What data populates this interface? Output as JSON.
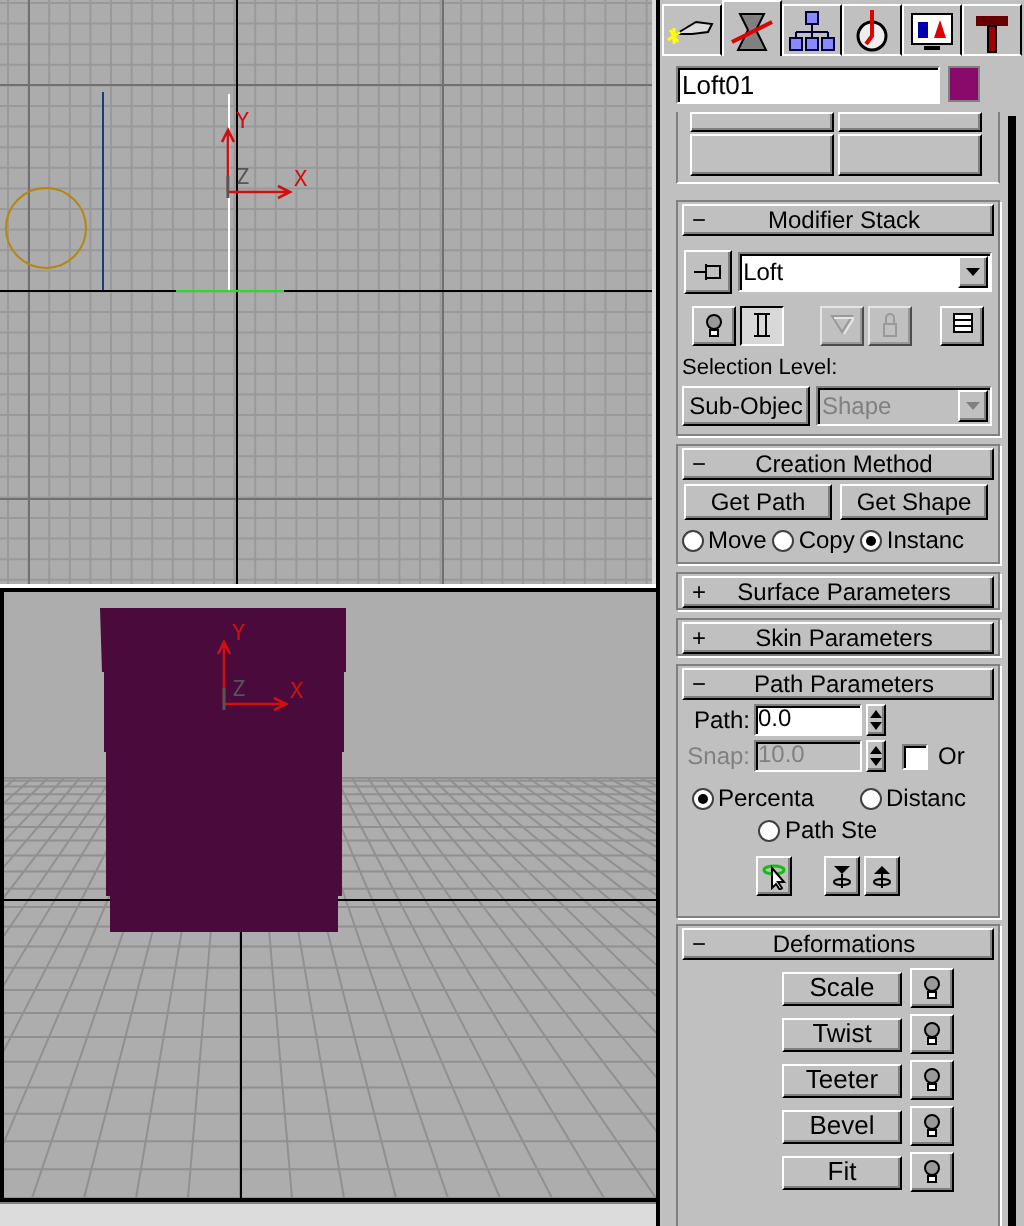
{
  "viewports": [
    {
      "kind": "top",
      "axis_labels": {
        "x": "X",
        "y": "Y",
        "z": "Z"
      }
    },
    {
      "kind": "perspective",
      "axis_labels": {
        "x": "X",
        "y": "Y",
        "z": "Z"
      }
    }
  ],
  "command_tabs": [
    {
      "kind": "create",
      "selected": false
    },
    {
      "kind": "modify",
      "selected": true
    },
    {
      "kind": "hierarchy",
      "selected": false
    },
    {
      "kind": "motion",
      "selected": false
    },
    {
      "kind": "display",
      "selected": false
    },
    {
      "kind": "utilities",
      "selected": false
    }
  ],
  "object": {
    "name": "Loft01",
    "color": "#8a0a6c"
  },
  "modifier_stack": {
    "toggle": "−",
    "title": "Modifier Stack",
    "stack_value": "Loft",
    "tools": [
      {
        "kind": "bulb",
        "pressed": false,
        "disabled": false
      },
      {
        "kind": "ibar",
        "pressed": true,
        "disabled": false
      },
      {
        "kind": "funnel",
        "pressed": false,
        "disabled": true
      },
      {
        "kind": "lock",
        "pressed": false,
        "disabled": true
      },
      {
        "kind": "stack",
        "pressed": false,
        "disabled": false
      }
    ],
    "selection_level_label": "Selection Level:",
    "sub_object_button": "Sub-Objec",
    "level_dropdown": {
      "value": "Shape",
      "disabled": true
    }
  },
  "creation_method": {
    "toggle": "−",
    "title": "Creation Method",
    "buttons": [
      "Get Path",
      "Get Shape"
    ],
    "options": [
      {
        "label": "Move",
        "selected": false
      },
      {
        "label": "Copy",
        "selected": false
      },
      {
        "label": "Instanc",
        "selected": true
      }
    ]
  },
  "surface_parameters": {
    "toggle": "+",
    "title": "Surface Parameters"
  },
  "skin_parameters": {
    "toggle": "+",
    "title": "Skin Parameters"
  },
  "path_parameters": {
    "toggle": "−",
    "title": "Path Parameters",
    "path": {
      "label": "Path:",
      "value": "0.0",
      "disabled": false
    },
    "snap": {
      "label": "Snap:",
      "value": "10.0",
      "disabled": true
    },
    "snap_on": {
      "label": "Or",
      "checked": false
    },
    "options": [
      {
        "label": "Percenta",
        "selected": true
      },
      {
        "label": "Distanc",
        "selected": false
      },
      {
        "label": "Path Ste",
        "selected": false
      }
    ],
    "tools": [
      {
        "kind": "pick"
      },
      {
        "kind": "previous"
      },
      {
        "kind": "next"
      }
    ]
  },
  "deformations": {
    "toggle": "−",
    "title": "Deformations",
    "items": [
      {
        "label": "Scale"
      },
      {
        "label": "Twist"
      },
      {
        "label": "Teeter"
      },
      {
        "label": "Bevel"
      },
      {
        "label": "Fit"
      }
    ]
  }
}
